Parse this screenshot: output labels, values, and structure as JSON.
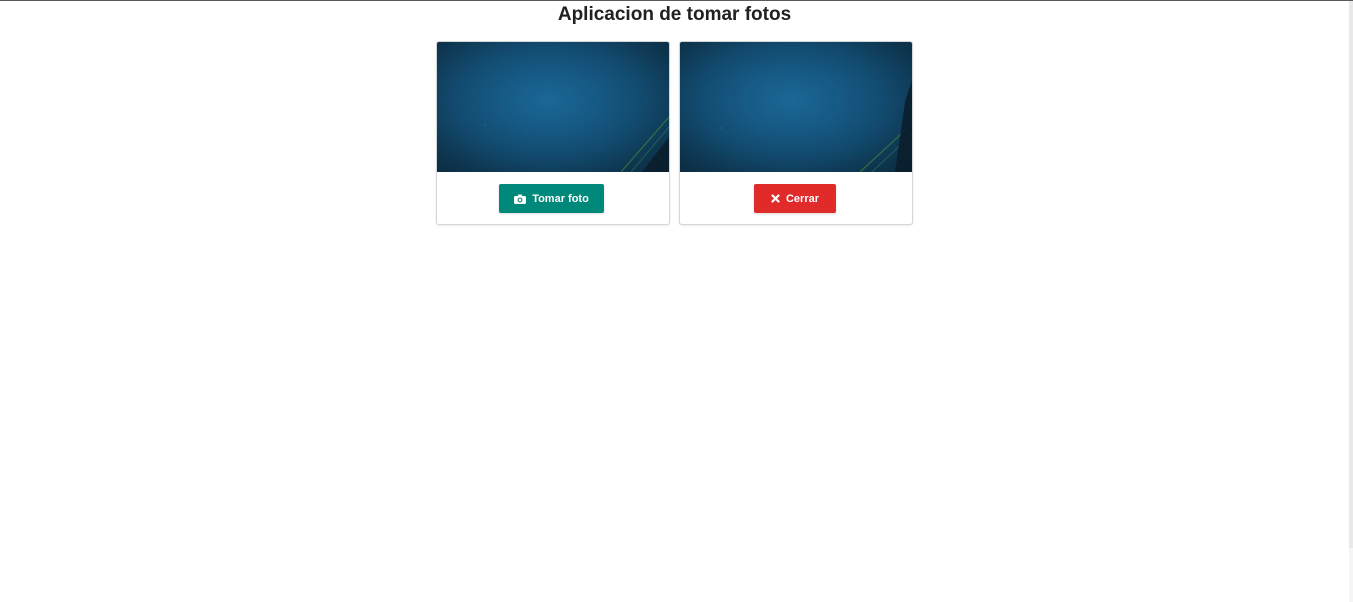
{
  "page": {
    "title": "Aplicacion de tomar fotos"
  },
  "cards": [
    {
      "button_label": "Tomar foto",
      "button_icon": "camera-icon",
      "button_color": "#00897b"
    },
    {
      "button_label": "Cerrar",
      "button_icon": "close-icon",
      "button_color": "#e12b2b"
    }
  ]
}
